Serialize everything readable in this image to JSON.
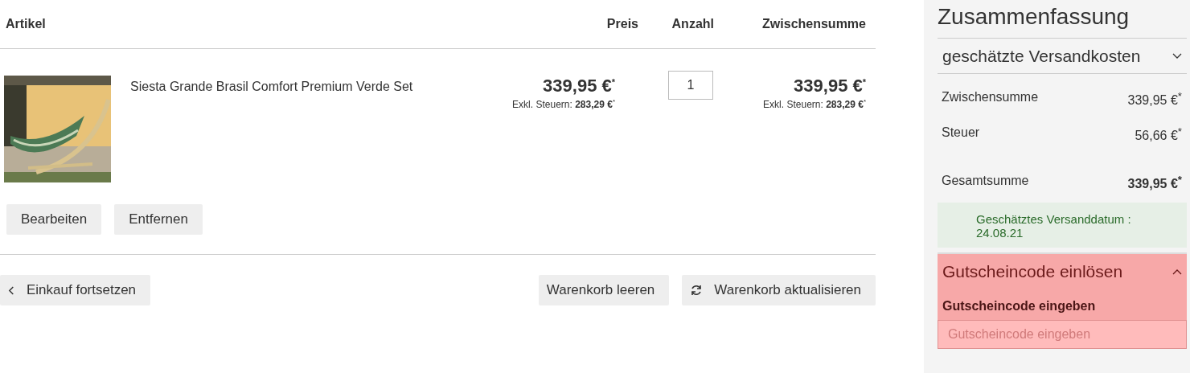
{
  "cart": {
    "columns": [
      "Artikel",
      "Preis",
      "Anzahl",
      "Zwischensumme"
    ],
    "items": [
      {
        "image": {
          "kind": "picture"
        },
        "name": "Siesta Grande Brasil Comfort Premium Verde Set",
        "price": "339,95 €$^{*}$",
        "price_excl": "Exkl. Steuern: **283,29 €**$^{*}$",
        "quantity": "1",
        "subtotal": "339,95 €$^{*}$",
        "subtotal_excl": "Exkl. Steuern: **283,29 €**$^{*}$",
        "actions": [
          "Bearbeiten",
          "Entfernen"
        ]
      }
    ],
    "continue_button": "Einkauf fortsetzen",
    "clear_button": "Warenkorb leeren",
    "update_button": "Warenkorb aktualisieren"
  },
  "summary": {
    "title": "Zusammenfassung",
    "shipping": {
      "label": "geschätzte Versandkosten",
      "expanded": false
    },
    "totals": [
      {
        "label": "Zwischensumme",
        "value": "339,95 €$^{*}$",
        "kind": "normal"
      },
      {
        "label": "Steuer",
        "value": "56,66 €$^{*}$",
        "kind": "normal"
      },
      {
        "label": "Gesamtsumme",
        "value": "339,95 €$^{*}$",
        "kind": "grand"
      }
    ],
    "shipping_date": "Geschätztes Versanddatum : 24.08.21",
    "coupon": {
      "label": "Gutscheincode einlösen",
      "expanded": true,
      "field_label": "Gutscheincode eingeben",
      "placeholder": "Gutscheincode eingeben"
    }
  }
}
